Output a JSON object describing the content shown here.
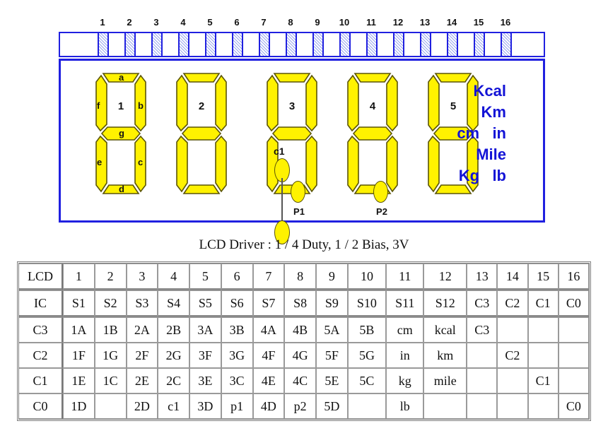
{
  "pin_numbers": [
    "1",
    "2",
    "3",
    "4",
    "5",
    "6",
    "7",
    "8",
    "9",
    "10",
    "11",
    "12",
    "13",
    "14",
    "15",
    "16"
  ],
  "display": {
    "digits": [
      {
        "index": "1",
        "show_segment_labels": true,
        "segment_labels": {
          "a": "a",
          "b": "b",
          "c": "c",
          "d": "d",
          "e": "e",
          "f": "f",
          "g": "g"
        }
      },
      {
        "index": "2",
        "show_segment_labels": false
      },
      {
        "index": "3",
        "show_segment_labels": false
      },
      {
        "index": "4",
        "show_segment_labels": false
      },
      {
        "index": "5",
        "show_segment_labels": false
      }
    ],
    "colon_label": "c1",
    "decimal_points": [
      {
        "label": "P1"
      },
      {
        "label": "P2"
      }
    ],
    "units": [
      "Kcal",
      "Km",
      "cm   in",
      "Mile",
      "Kg   lb"
    ]
  },
  "caption": "LCD Driver : 1 / 4 Duty, 1 / 2 Bias, 3V",
  "table": {
    "rows": [
      {
        "head": "LCD",
        "cells": [
          "1",
          "2",
          "3",
          "4",
          "5",
          "6",
          "7",
          "8",
          "9",
          "10",
          "11",
          "12",
          "13",
          "14",
          "15",
          "16"
        ]
      },
      {
        "head": "IC",
        "cells": [
          "S1",
          "S2",
          "S3",
          "S4",
          "S5",
          "S6",
          "S7",
          "S8",
          "S9",
          "S10",
          "S11",
          "S12",
          "C3",
          "C2",
          "C1",
          "C0"
        ]
      },
      {
        "head": "C3",
        "cells": [
          "1A",
          "1B",
          "2A",
          "2B",
          "3A",
          "3B",
          "4A",
          "4B",
          "5A",
          "5B",
          "cm",
          "kcal",
          "C3",
          "",
          "",
          ""
        ]
      },
      {
        "head": "C2",
        "cells": [
          "1F",
          "1G",
          "2F",
          "2G",
          "3F",
          "3G",
          "4F",
          "4G",
          "5F",
          "5G",
          "in",
          "km",
          "",
          "C2",
          "",
          ""
        ]
      },
      {
        "head": "C1",
        "cells": [
          "1E",
          "1C",
          "2E",
          "2C",
          "3E",
          "3C",
          "4E",
          "4C",
          "5E",
          "5C",
          "kg",
          "mile",
          "",
          "",
          "C1",
          ""
        ]
      },
      {
        "head": "C0",
        "cells": [
          "1D",
          "",
          "2D",
          "c1",
          "3D",
          "p1",
          "4D",
          "p2",
          "5D",
          "",
          "lb",
          "",
          "",
          "",
          "",
          "C0"
        ]
      }
    ]
  },
  "colors": {
    "segment_fill": "#FFF200",
    "segment_stroke": "#5a5406",
    "frame_blue": "#2020e0",
    "unit_text_blue": "#1313d6"
  }
}
